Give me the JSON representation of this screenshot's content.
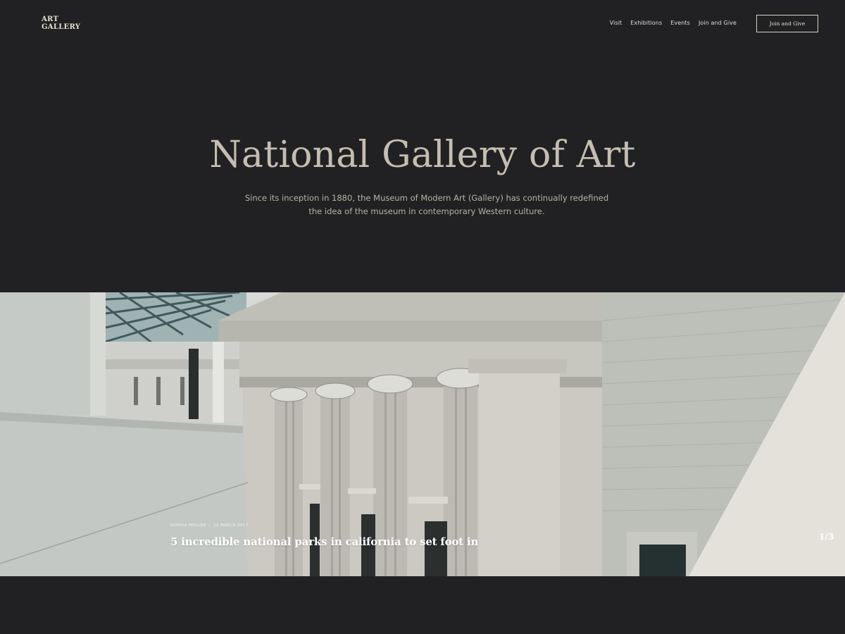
{
  "header": {
    "logo_line1": "ART",
    "logo_line2": "GALLERY",
    "nav": [
      "Visit",
      "Exhibitions",
      "Events",
      "Join and Give"
    ],
    "cta_label": "Join and Give"
  },
  "hero": {
    "title": "National Gallery of Art",
    "subtitle": "Since its inception in 1880, the Museum of Modern Art (Gallery) has continually redefined the idea of the museum in contemporary Western culture."
  },
  "slide": {
    "meta": "JOSHUA MOLLER — 22 MARCH 2017",
    "title": "5 incredible national parks in california to set foot in",
    "counter": "1/3"
  },
  "colors": {
    "background": "#212123",
    "title": "#c5bdb0",
    "text": "#e2ddd3"
  }
}
